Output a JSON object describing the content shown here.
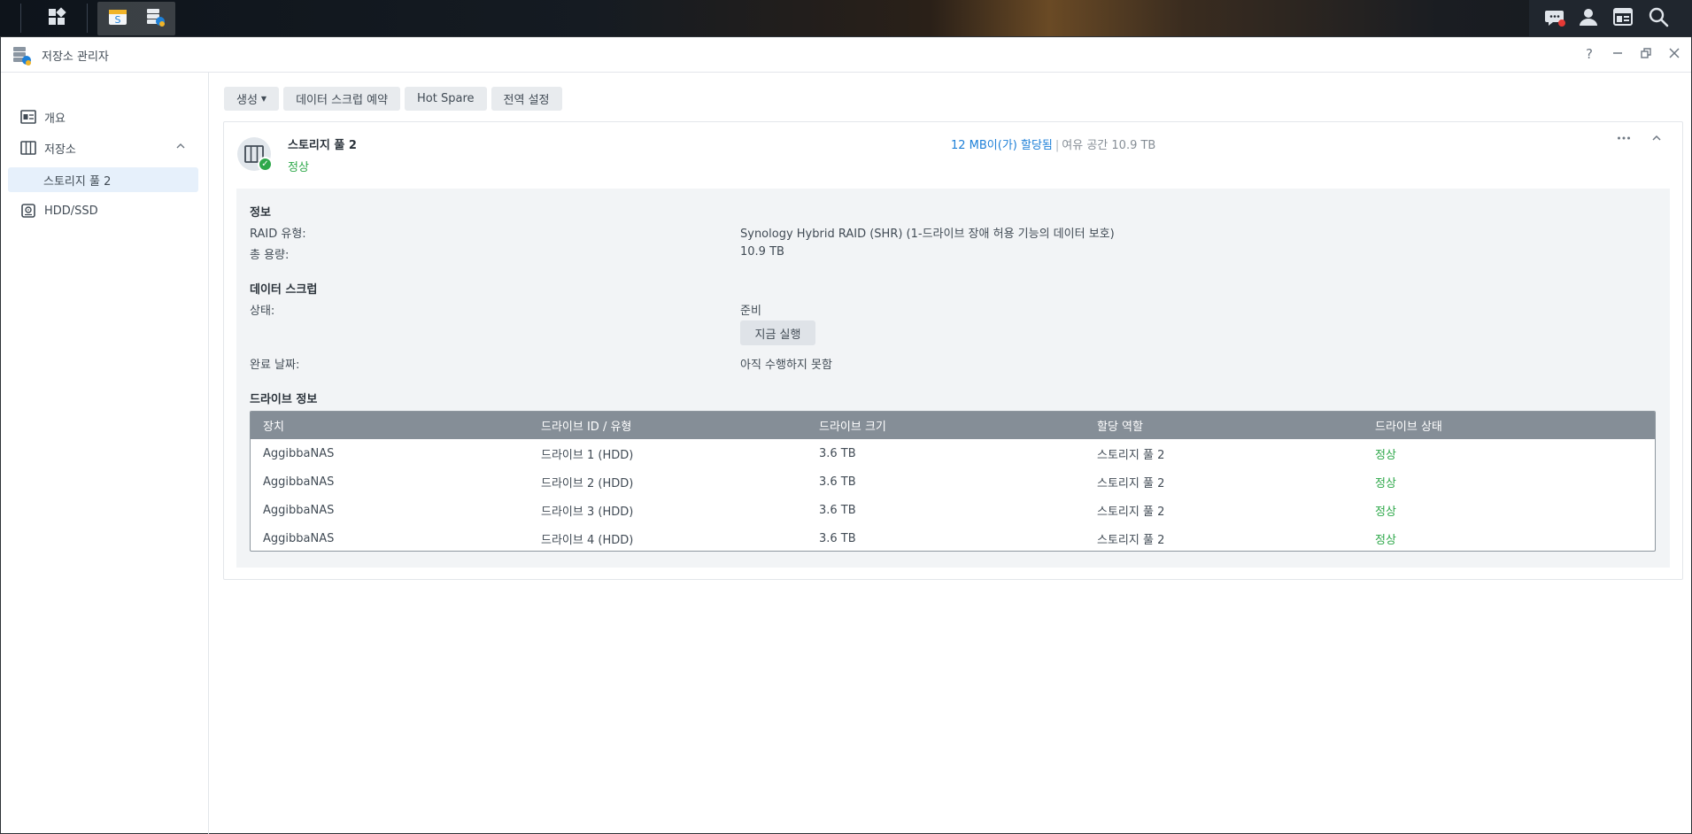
{
  "taskbar": {
    "icons": [
      "main-menu-icon",
      "app-package-icon",
      "storage-manager-icon",
      "notification-icon",
      "user-icon",
      "widgets-icon",
      "search-icon"
    ]
  },
  "window": {
    "title": "저장소 관리자",
    "controls": [
      "help-icon",
      "minimize-icon",
      "restore-icon",
      "close-icon"
    ]
  },
  "sidebar": {
    "items": [
      {
        "label": "개요",
        "icon": "overview-icon"
      },
      {
        "label": "저장소",
        "icon": "storage-icon"
      },
      {
        "label": "스토리지 풀 2"
      },
      {
        "label": "HDD/SSD",
        "icon": "hdd-icon"
      }
    ]
  },
  "toolbar": {
    "create": "생성",
    "scrub_schedule": "데이터 스크럽 예약",
    "hot_spare": "Hot Spare",
    "global_settings": "전역 설정"
  },
  "pool": {
    "name": "스토리지 풀 2",
    "status": "정상",
    "allocated": "12 MB이(가) 할당됨",
    "separator": "|",
    "free_label": "여유 공간",
    "free_value": "10.9 TB"
  },
  "info": {
    "title": "정보",
    "raid_label": "RAID 유형:",
    "raid_value": "Synology Hybrid RAID (SHR) (1-드라이브 장애 허용 기능의 데이터 보호)",
    "capacity_label": "총 용량:",
    "capacity_value": "10.9 TB"
  },
  "scrub": {
    "title": "데이터 스크럽",
    "status_label": "상태:",
    "status_value": "준비",
    "run_now": "지금 실행",
    "completed_label": "완료 날짜:",
    "completed_value": "아직 수행하지 못함"
  },
  "drives": {
    "title": "드라이브 정보",
    "columns": [
      "장치",
      "드라이브 ID / 유형",
      "드라이브 크기",
      "할당 역할",
      "드라이브 상태"
    ],
    "rows": [
      [
        "AggibbaNAS",
        "드라이브 1 (HDD)",
        "3.6 TB",
        "스토리지 풀 2",
        "정상"
      ],
      [
        "AggibbaNAS",
        "드라이브 2 (HDD)",
        "3.6 TB",
        "스토리지 풀 2",
        "정상"
      ],
      [
        "AggibbaNAS",
        "드라이브 3 (HDD)",
        "3.6 TB",
        "스토리지 풀 2",
        "정상"
      ],
      [
        "AggibbaNAS",
        "드라이브 4 (HDD)",
        "3.6 TB",
        "스토리지 풀 2",
        "정상"
      ]
    ]
  },
  "colors": {
    "accent": "#1e80d8",
    "healthy": "#2ea84a",
    "table_header": "#858e97",
    "selected_bg": "#e6f0fb"
  }
}
